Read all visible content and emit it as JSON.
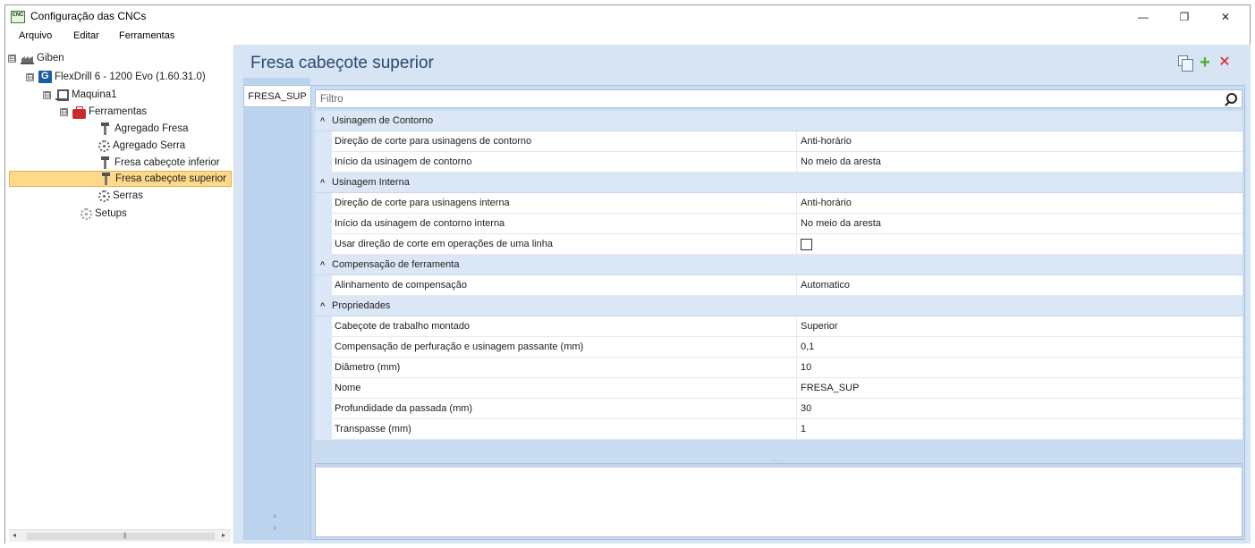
{
  "window": {
    "title": "Configuração das CNCs",
    "icon_label": "CNC",
    "controls": {
      "minimize": "—",
      "maximize": "❐",
      "close": "✕"
    }
  },
  "menu": [
    "Arquivo",
    "Editar",
    "Ferramentas"
  ],
  "tree": {
    "root": {
      "label": "Giben",
      "expander": "⊟",
      "icon": "factory-icon"
    },
    "machine_family": {
      "label": "FlexDrill 6 - 1200 Evo (1.60.31.0)",
      "expander": "⊟",
      "icon": "flexdrill-icon"
    },
    "machine": {
      "label": "Maquina1",
      "expander": "⊟",
      "icon": "machine-icon"
    },
    "tools_folder": {
      "label": "Ferramentas",
      "expander": "⊟",
      "icon": "toolbox-icon"
    },
    "tools": [
      {
        "label": "Agregado Fresa",
        "icon": "mill-icon"
      },
      {
        "label": "Agregado Serra",
        "icon": "saw-icon"
      },
      {
        "label": "Fresa cabeçote inferior",
        "icon": "mill-icon"
      },
      {
        "label": "Fresa cabeçote superior",
        "icon": "mill-icon",
        "selected": true
      },
      {
        "label": "Serras",
        "icon": "saw-icon"
      }
    ],
    "setups": {
      "label": "Setups",
      "icon": "gear-icon"
    },
    "scroll": {
      "left": "◂",
      "right": "▸",
      "grip": "|||"
    }
  },
  "detail": {
    "title": "Fresa cabeçote superior",
    "actions": {
      "copy": "copy-icon",
      "add": "+",
      "delete": "✕"
    },
    "tab": "FRESA_SUP",
    "tab_scroll": {
      "up": "▴",
      "down": "▾"
    },
    "filter_placeholder": "Filtro",
    "collapse_glyph": "^",
    "splitter_grip": ".....",
    "categories": [
      {
        "name": "Usinagem de Contorno",
        "rows": [
          {
            "name": "Direção de corte para usinagens de contorno",
            "value": "Anti-horário"
          },
          {
            "name": "Início da usinagem de contorno",
            "value": "No meio da aresta"
          }
        ]
      },
      {
        "name": "Usinagem Interna",
        "rows": [
          {
            "name": "Direção de corte para usinagens interna",
            "value": "Anti-horário"
          },
          {
            "name": "Início da usinagem de contorno interna",
            "value": "No meio da aresta"
          },
          {
            "name": "Usar direção de corte em operações de uma linha",
            "value": "",
            "checkbox": true,
            "checked": false
          }
        ]
      },
      {
        "name": "Compensação de ferramenta",
        "rows": [
          {
            "name": "Alinhamento de compensação",
            "value": "Automatico"
          }
        ]
      },
      {
        "name": "Propriedades",
        "rows": [
          {
            "name": "Cabeçote de trabalho montado",
            "value": "Superior"
          },
          {
            "name": "Compensação de perfuração e usinagem passante (mm)",
            "value": "0,1"
          },
          {
            "name": "Diâmetro (mm)",
            "value": "10"
          },
          {
            "name": "Nome",
            "value": "FRESA_SUP"
          },
          {
            "name": "Profundidade da passada (mm)",
            "value": "30"
          },
          {
            "name": "Transpasse (mm)",
            "value": "1"
          }
        ]
      }
    ]
  },
  "colors": {
    "panel_bg": "#d6e4f4",
    "category_bg": "#dbe7f6",
    "selection": "#fed98c",
    "title_text": "#2c4a6e",
    "add_green": "#4caf28",
    "delete_red": "#e02020"
  }
}
